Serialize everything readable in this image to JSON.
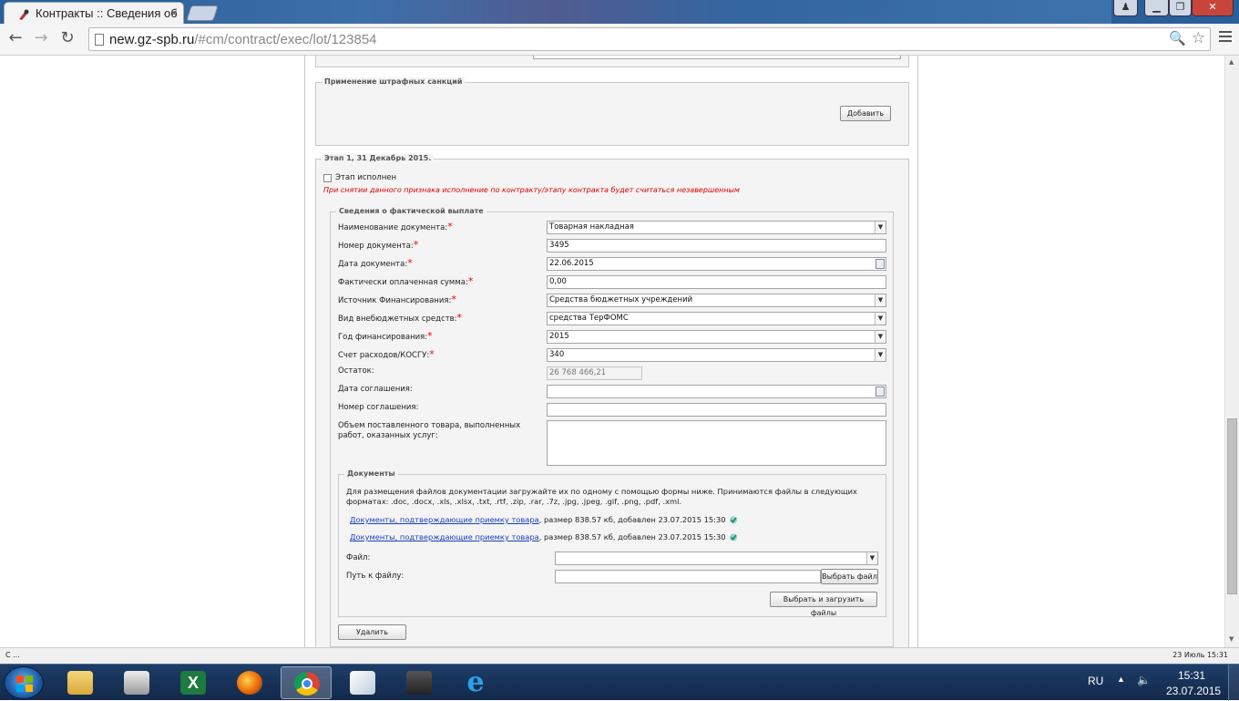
{
  "browser": {
    "tab_title": "Контракты :: Сведения об",
    "url_host": "new.gz-spb.ru",
    "url_path": "/#cm/contract/exec/lot/123854"
  },
  "penalties": {
    "legend": "Применение штрафных санкций",
    "add_button": "Добавить"
  },
  "stage": {
    "legend": "Этап 1, 31 Декабрь 2015.",
    "completed_label": "Этап исполнен",
    "completed_checked": false,
    "warning": "При снятии данного признака исполнение по контракту/этапу контракта будет считаться незавершенным"
  },
  "payment": {
    "legend": "Сведения о фактической выплате",
    "fields": {
      "doc_name": {
        "label": "Наименование документа:",
        "value": "Товарная накладная"
      },
      "doc_number": {
        "label": "Номер документа:",
        "value": "3495"
      },
      "doc_date": {
        "label": "Дата документа:",
        "value": "22.06.2015"
      },
      "paid_sum": {
        "label": "Фактически оплаченная сумма:",
        "value": "0,00"
      },
      "fin_source": {
        "label": "Источник Финансирования:",
        "value": "Средства бюджетных учреждений"
      },
      "offbudget_type": {
        "label": "Вид внебюджетных средств:",
        "value": "средства ТерФОМС"
      },
      "fin_year": {
        "label": "Год финансирования:",
        "value": "2015"
      },
      "kosgu": {
        "label": "Счет расходов/КОСГУ:",
        "value": "340"
      },
      "balance": {
        "label": "Остаток:",
        "value": "26 768 466,21"
      },
      "agreement_date": {
        "label": "Дата соглашения:",
        "value": ""
      },
      "agreement_number": {
        "label": "Номер соглашения:",
        "value": ""
      },
      "volume": {
        "label": "Объем поставленного товара, выполненных работ, оказанных услуг:",
        "value": ""
      }
    },
    "required_mark": "*"
  },
  "documents": {
    "legend": "Документы",
    "info": "Для размещения файлов документации загружайте их по одному с помощью формы ниже. Принимаются файлы в следующих форматах: .doc, .docx, .xls, .xlsx, .txt, .rtf, .zip, .rar, .7z, .jpg, .jpeg, .gif, .png, .pdf, .xml.",
    "files": [
      {
        "link": "Документы, подтверждающие приемку товара",
        "meta": ", размер 838.57 кб, добавлен 23.07.2015 15:30"
      },
      {
        "link": "Документы, подтверждающие приемку товара",
        "meta": ", размер 838.57 кб, добавлен 23.07.2015 15:30"
      }
    ],
    "file_label": "Файл:",
    "path_label": "Путь к файлу:",
    "choose_button": "Выбрать файл",
    "upload_button": "Выбрать и загрузить файлы"
  },
  "delete_button": "Удалить",
  "status": {
    "left": "C ...",
    "right": "23 Июль 15:31"
  },
  "tray": {
    "lang": "RU",
    "time": "15:31",
    "date": "23.07.2015"
  }
}
